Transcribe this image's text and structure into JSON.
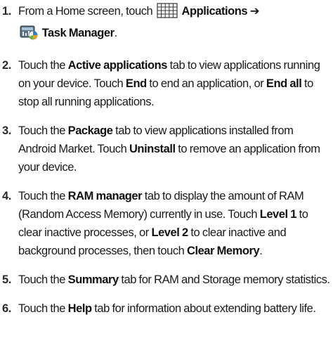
{
  "icons": {
    "apps_grid": "applications-grid-icon",
    "task_manager": "task-manager-icon"
  },
  "steps": [
    {
      "num": "1.",
      "a": "From a Home screen, touch",
      "b": "Applications",
      "arrow": "➔",
      "c": "Task Manager",
      "d": "."
    },
    {
      "num": "2.",
      "a": "Touch the ",
      "b": "Active applications",
      "c": " tab to view applications running on your device. Touch ",
      "d": "End",
      "e": " to end an application, or ",
      "f": "End all",
      "g": " to stop all running applications."
    },
    {
      "num": "3.",
      "a": "Touch the ",
      "b": "Package",
      "c": " tab to view applications installed from Android Market. Touch ",
      "d": "Uninstall",
      "e": " to remove an application from your device."
    },
    {
      "num": "4.",
      "a": "Touch the ",
      "b": "RAM manager",
      "c": "  tab to display the amount of RAM (Random Access Memory) currently in use.  Touch ",
      "d": "Level 1",
      "e": " to clear inactive processes, or ",
      "f": "Level 2",
      "g": " to clear inactive and background processes, then touch ",
      "h": "Clear Memory",
      "i": "."
    },
    {
      "num": "5.",
      "a": "Touch the ",
      "b": "Summary",
      "c": " tab for RAM and Storage memory statistics."
    },
    {
      "num": "6.",
      "a": "Touch the ",
      "b": "Help",
      "c": "  tab for information about extending battery life."
    }
  ]
}
